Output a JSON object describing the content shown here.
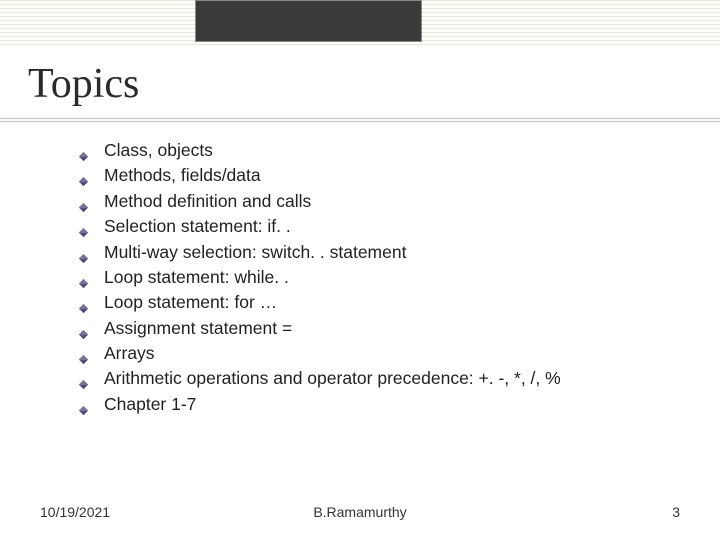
{
  "title": "Topics",
  "bullets": [
    "Class, objects",
    "Methods, fields/data",
    "Method definition and calls",
    "Selection statement: if. .",
    "Multi-way selection: switch. . statement",
    "Loop statement: while. .",
    "Loop statement: for …",
    "Assignment statement =",
    "Arrays",
    "Arithmetic operations and operator precedence: +. -, *, /, %",
    "Chapter 1-7"
  ],
  "footer": {
    "date": "10/19/2021",
    "author": "B.Ramamurthy",
    "page": "3"
  },
  "bullet_colors": {
    "fill": "#7a6f9e",
    "shadow": "#4b4370"
  }
}
